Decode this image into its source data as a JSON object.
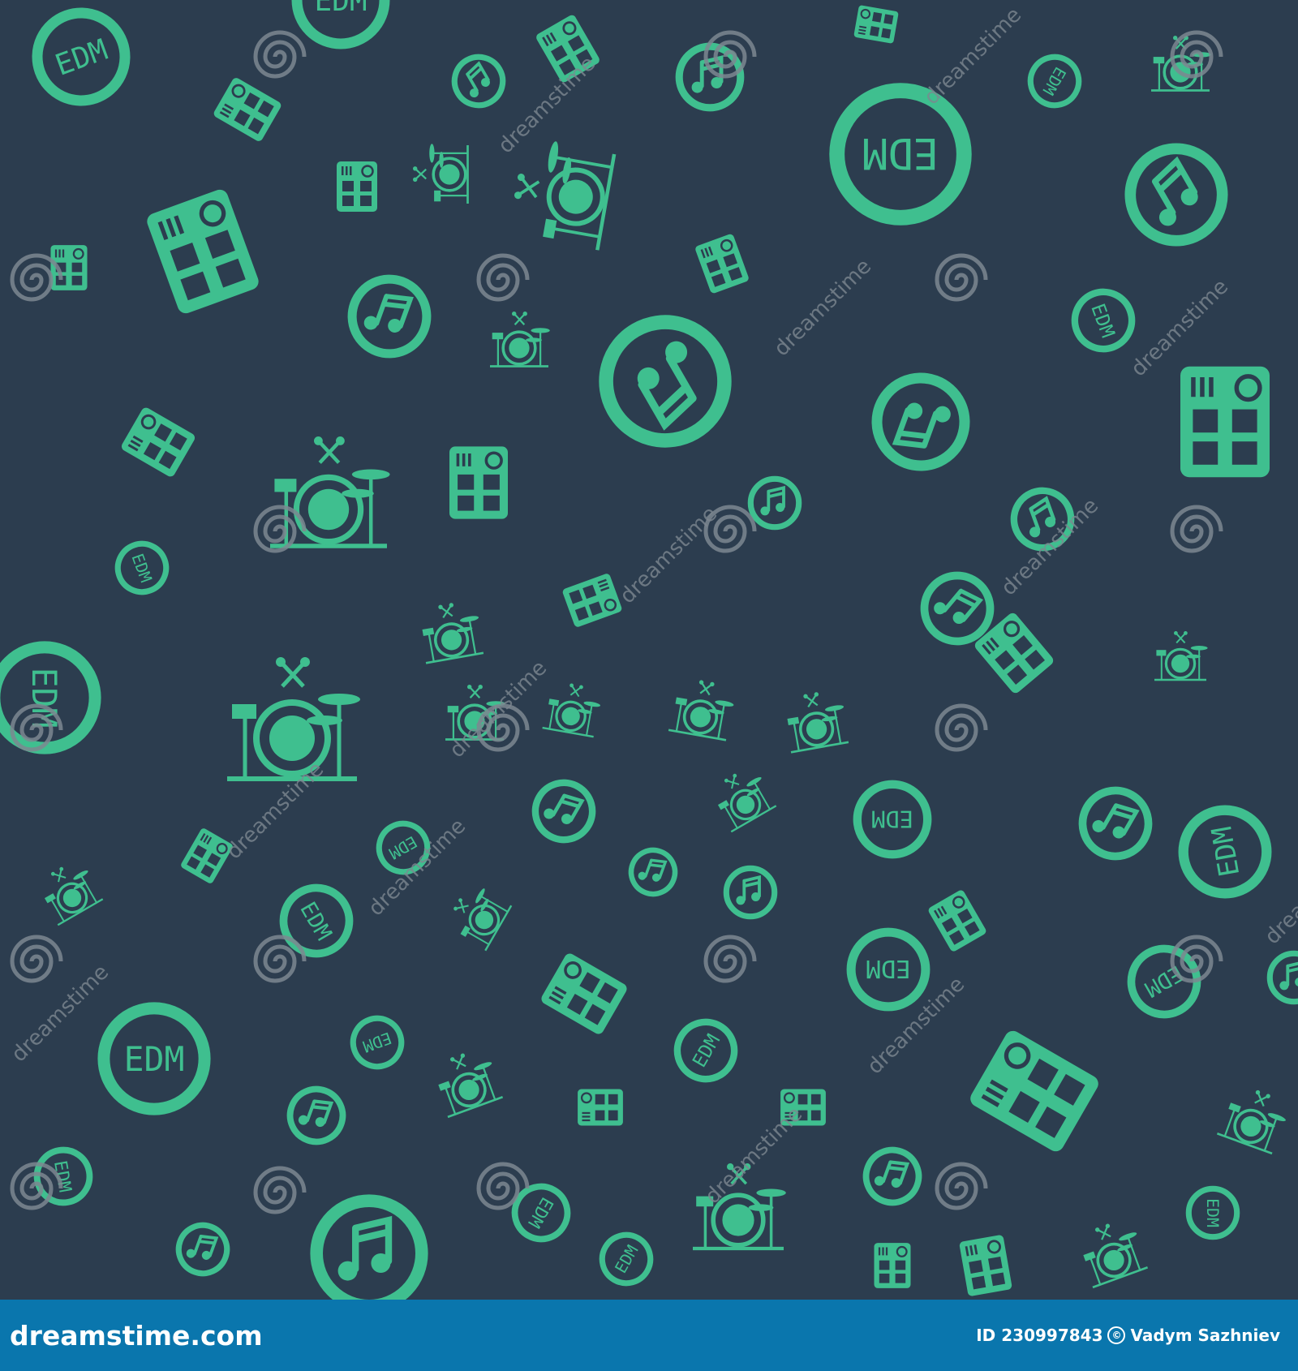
{
  "pattern": {
    "background_color": "#2c3d4f",
    "icon_color": "#3fbf8f",
    "icons": [
      "edm-badge-icon",
      "music-note-badge-icon",
      "drum-machine-icon",
      "drum-set-icon"
    ],
    "edm_label": "EDM",
    "watermark_text": "dreamstime",
    "watermark_icon": "dreamstime-spiral-icon",
    "watermark_color": "#7d8790"
  },
  "footer": {
    "background_color": "#0a76ad",
    "brand": "dreamstime.com",
    "image_id": "ID 230997843",
    "author": "Vadym Sazhniev",
    "copyright_symbol": "©"
  }
}
